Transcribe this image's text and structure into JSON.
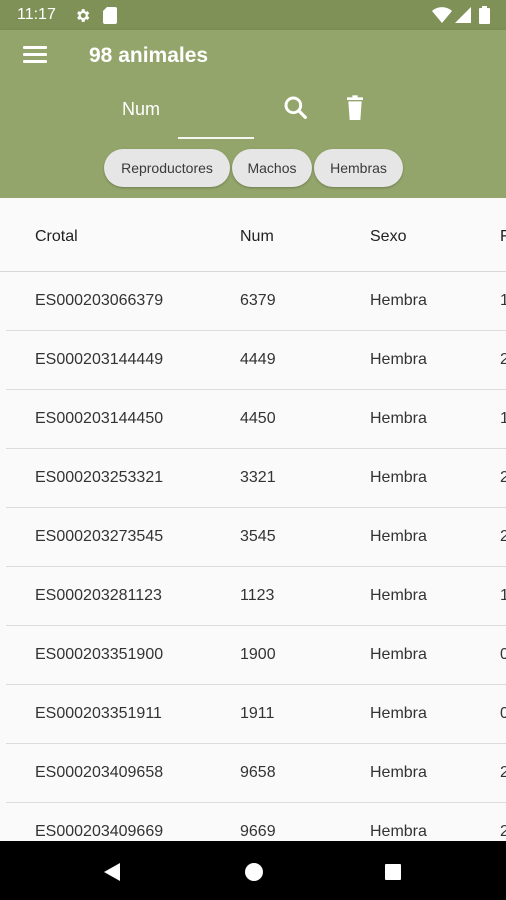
{
  "status_bar": {
    "time": "11:17"
  },
  "app_bar": {
    "title": "98 animales"
  },
  "search": {
    "placeholder": "Num"
  },
  "filters": [
    "Reproductores",
    "Machos",
    "Hembras"
  ],
  "table": {
    "headers": [
      "Crotal",
      "Num",
      "Sexo",
      "F"
    ],
    "rows": [
      {
        "crotal": "ES000203066379",
        "num": "6379",
        "sexo": "Hembra",
        "f": "1"
      },
      {
        "crotal": "ES000203144449",
        "num": "4449",
        "sexo": "Hembra",
        "f": "2"
      },
      {
        "crotal": "ES000203144450",
        "num": "4450",
        "sexo": "Hembra",
        "f": "1"
      },
      {
        "crotal": "ES000203253321",
        "num": "3321",
        "sexo": "Hembra",
        "f": "2"
      },
      {
        "crotal": "ES000203273545",
        "num": "3545",
        "sexo": "Hembra",
        "f": "2"
      },
      {
        "crotal": "ES000203281123",
        "num": "1123",
        "sexo": "Hembra",
        "f": "1"
      },
      {
        "crotal": "ES000203351900",
        "num": "1900",
        "sexo": "Hembra",
        "f": "0"
      },
      {
        "crotal": "ES000203351911",
        "num": "1911",
        "sexo": "Hembra",
        "f": "0"
      },
      {
        "crotal": "ES000203409658",
        "num": "9658",
        "sexo": "Hembra",
        "f": "2"
      },
      {
        "crotal": "ES000203409669",
        "num": "9669",
        "sexo": "Hembra",
        "f": "2"
      }
    ]
  },
  "icons": {
    "menu": "menu-icon",
    "search": "search-icon",
    "delete": "trash-icon",
    "settings": "gear-icon",
    "sd": "sd-card-icon",
    "wifi": "wifi-icon",
    "signal": "signal-icon",
    "battery": "battery-icon",
    "back": "back-icon",
    "home": "home-icon",
    "recents": "recents-icon"
  },
  "colors": {
    "status_bar": "#7f9157",
    "app_bar": "#93a56b",
    "chip": "#e6e6e6",
    "nav_bar": "#000000"
  }
}
